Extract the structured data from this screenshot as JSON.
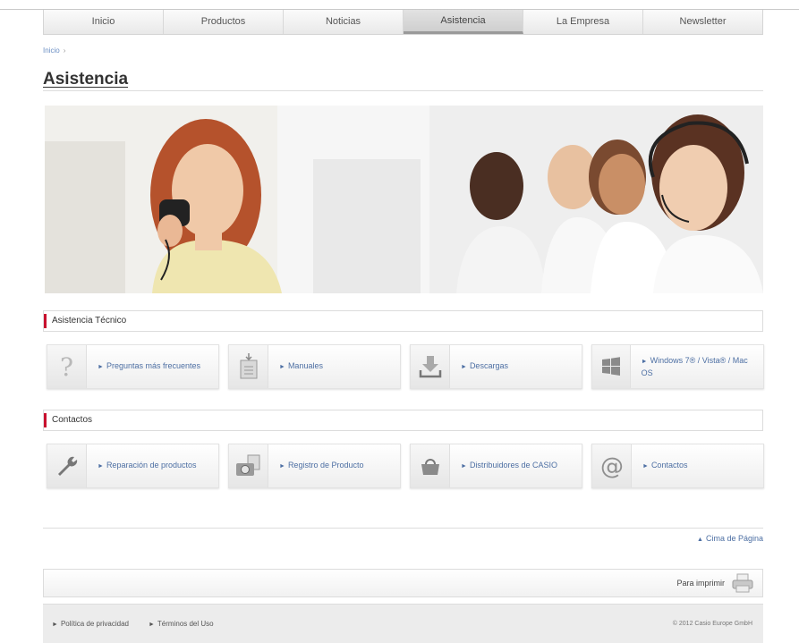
{
  "nav": {
    "items": [
      {
        "label": "Inicio"
      },
      {
        "label": "Productos"
      },
      {
        "label": "Noticias"
      },
      {
        "label": "Asistencia"
      },
      {
        "label": "La Empresa"
      },
      {
        "label": "Newsletter"
      }
    ],
    "active": "Asistencia"
  },
  "breadcrumb": {
    "home": "Inicio",
    "separator": "›"
  },
  "page": {
    "title": "Asistencia"
  },
  "hero": {
    "image": "customer-support-agents-with-headsets"
  },
  "support": {
    "title": "Asistencia Técnico",
    "tiles": [
      {
        "label": "Preguntas más frecuentes",
        "icon": "question-mark-icon"
      },
      {
        "label": "Manuales",
        "icon": "manual-icon"
      },
      {
        "label": "Descargas",
        "icon": "download-icon"
      },
      {
        "label": "Windows 7® / Vista® / Mac OS",
        "icon": "windows-logo-icon"
      }
    ]
  },
  "contacts": {
    "title": "Contactos",
    "tiles": [
      {
        "label": "Reparación de productos",
        "icon": "wrench-icon"
      },
      {
        "label": "Registro de Producto",
        "icon": "camera-register-icon"
      },
      {
        "label": "Distribuidores de CASIO",
        "icon": "shopping-basket-icon"
      },
      {
        "label": "Contactos",
        "icon": "at-sign-icon"
      }
    ]
  },
  "back_to_top": "Cima de Página",
  "print": {
    "label": "Para imprimir"
  },
  "footer": {
    "links": [
      {
        "label": "Política de privacidad"
      },
      {
        "label": "Términos del Uso"
      }
    ],
    "copyright": "© 2012 Casio Europe GmbH"
  },
  "colors": {
    "accent": "#c8102e",
    "link": "#4d6fa3"
  }
}
